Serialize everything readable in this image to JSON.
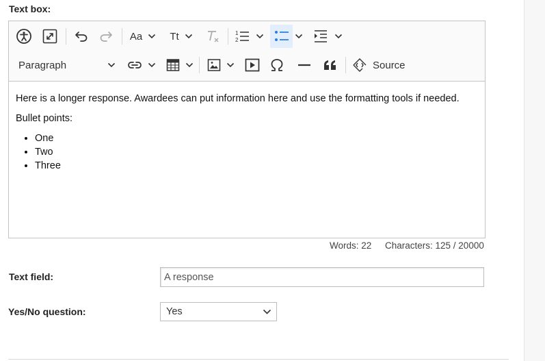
{
  "text_box": {
    "label": "Text box:",
    "toolbar": {
      "font_family_label": "Aa",
      "font_size_label": "Tt",
      "paragraph_label": "Paragraph",
      "source_label": "Source",
      "bulleted_list_active": true
    },
    "content": {
      "paragraph1": "Here is a longer response. Awardees can put information here and use the formatting tools if needed.",
      "paragraph2": "Bullet points:",
      "bullets": [
        "One",
        "Two",
        "Three"
      ]
    },
    "counter": {
      "words": "Words: 22",
      "characters": "Characters: 125 / 20000"
    }
  },
  "text_field": {
    "label": "Text field:",
    "value": "A response"
  },
  "yes_no": {
    "label": "Yes/No question:",
    "selected": "Yes"
  },
  "colors": {
    "active_button_bg": "#e3eefc",
    "active_icon": "#2a7de1",
    "toolbar_bg": "#fafafa",
    "border": "#c4c4c4"
  }
}
